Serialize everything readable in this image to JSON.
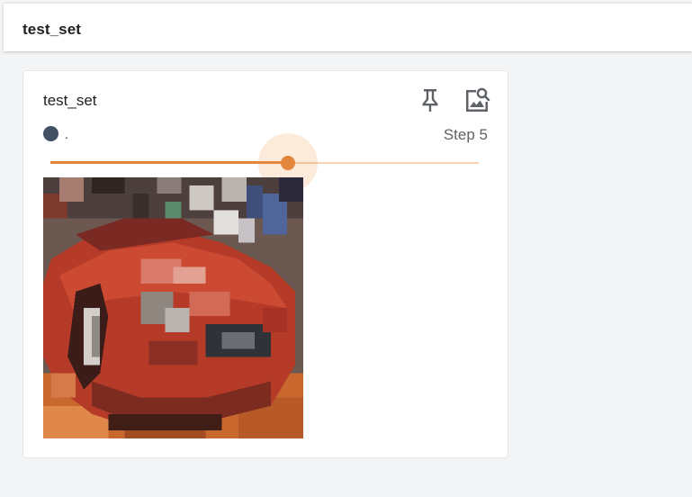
{
  "header": {
    "group_title": "test_set"
  },
  "card": {
    "title": "test_set",
    "run_name": ".",
    "run_color": "#425066",
    "step_label": "Step 5",
    "slider": {
      "accent": "#e4853d",
      "fraction": 0.555
    },
    "actions": {
      "pin_icon": "pin-icon",
      "enlarge_icon": "image-search-icon"
    },
    "image": {
      "subject": "pixelated red car"
    }
  }
}
